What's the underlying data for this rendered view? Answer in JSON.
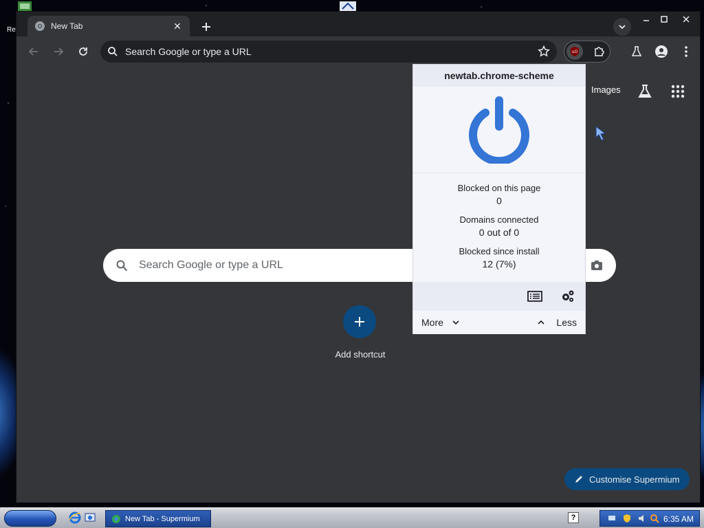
{
  "desktop": {
    "left_text": "Re"
  },
  "browser": {
    "tab": {
      "title": "New Tab"
    },
    "omnibox": {
      "placeholder": "Search Google or type a URL"
    }
  },
  "ntp": {
    "images_link": "Images",
    "search_placeholder": "Search Google or type a URL",
    "add_shortcut": "Add shortcut",
    "customise_label": "Customise Supermium"
  },
  "ublock_popup": {
    "hostname": "newtab.chrome-scheme",
    "stats": [
      {
        "label": "Blocked on this page",
        "value": "0"
      },
      {
        "label": "Domains connected",
        "value": "0 out of 0"
      },
      {
        "label": "Blocked since install",
        "value": "12 (7%)"
      }
    ],
    "more_label": "More",
    "less_label": "Less",
    "power_color": "#3475d6"
  },
  "taskbar": {
    "task_label": "New Tab - Supermium",
    "clock": "6:35 AM"
  },
  "colors": {
    "browser_bg": "#35363a",
    "accent_button": "#0b4a80"
  }
}
